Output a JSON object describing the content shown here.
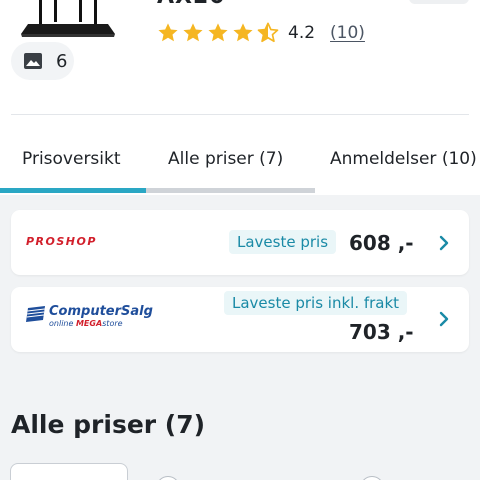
{
  "product": {
    "title_fragment": "AX20",
    "image_count": "6",
    "rating_value": "4.2",
    "rating_count": "(10)",
    "star_color": "#f5b622"
  },
  "tabs": [
    {
      "label": "Prisoversikt",
      "active": true
    },
    {
      "label": "Alle priser (7)",
      "active": false
    },
    {
      "label": "Anmeldelser (10)",
      "active": false
    }
  ],
  "offers": [
    {
      "store": "PROSHOP",
      "badge": "Laveste pris",
      "price": "608 ,-"
    },
    {
      "store_name": "ComputerSalg",
      "store_sub_prefix": "online ",
      "store_sub_highlight": "MEGA",
      "store_sub_suffix": "store",
      "badge": "Laveste pris inkl. frakt",
      "price": "703 ,-"
    }
  ],
  "section": {
    "title": "Alle priser (7)"
  },
  "colors": {
    "accent": "#2aa7c4",
    "badge_text": "#1a8aa6",
    "proshop_red": "#d21f2b",
    "computersalg_blue": "#1f4e9b"
  }
}
